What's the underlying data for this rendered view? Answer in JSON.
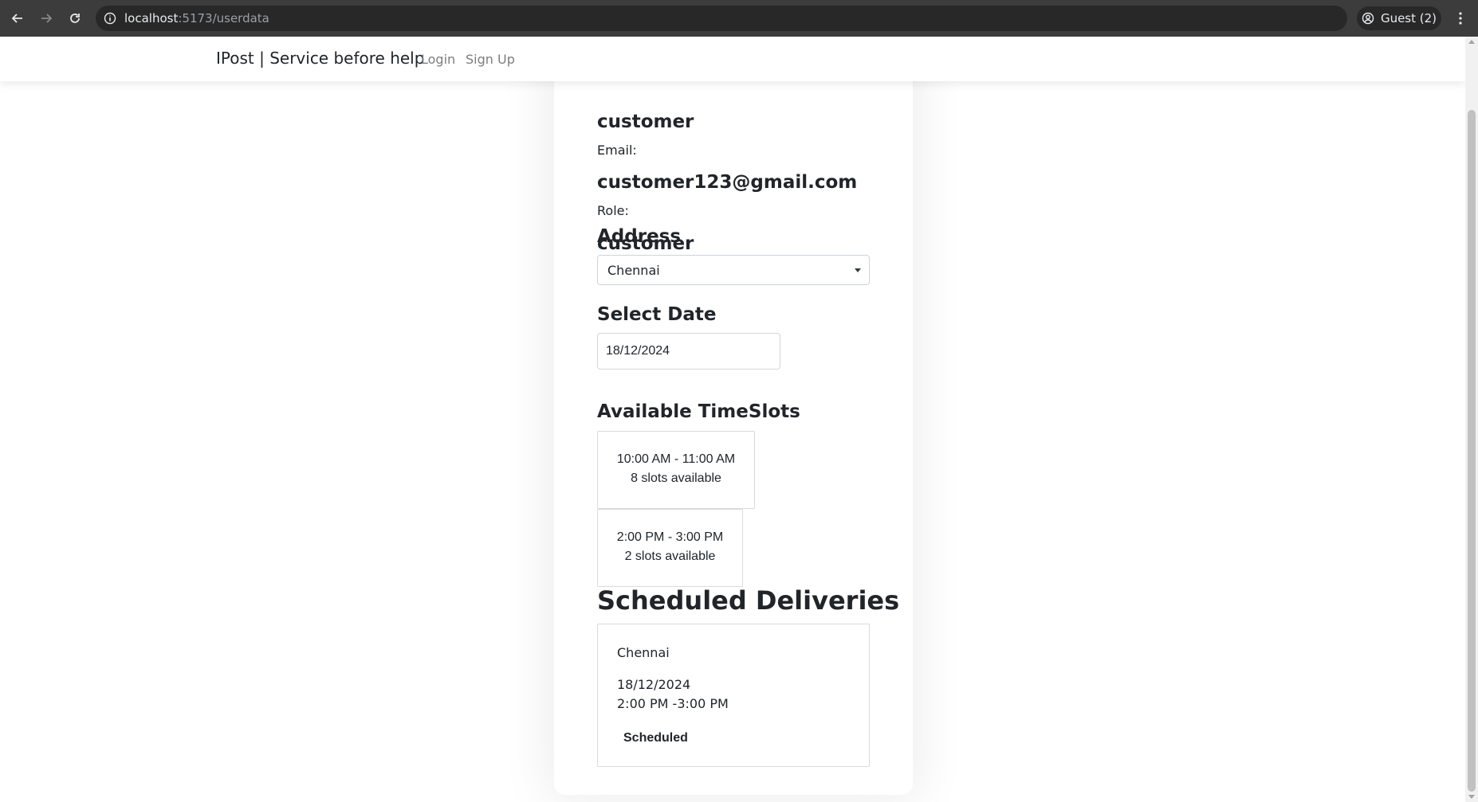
{
  "browser": {
    "url_host": "localhost",
    "url_path": ":5173/userdata",
    "profile_label": "Guest (2)"
  },
  "navbar": {
    "brand": "IPost | Service before help",
    "login": "Login",
    "signup": "Sign Up"
  },
  "profile": {
    "name_value": "customer",
    "email_label": "Email:",
    "email_value": "customer123@gmail.com",
    "role_label": "Role:",
    "role_value": "customer"
  },
  "address": {
    "heading": "Address",
    "selected": "Chennai"
  },
  "date": {
    "heading": "Select Date",
    "value": "18/12/2024"
  },
  "timeslots": {
    "heading": "Available TimeSlots",
    "items": [
      {
        "time": "10:00 AM - 11:00 AM",
        "availability": "8 slots available"
      },
      {
        "time": "2:00 PM - 3:00 PM",
        "availability": "2 slots available"
      }
    ]
  },
  "deliveries": {
    "heading": "Scheduled Deliveries",
    "items": [
      {
        "location": "Chennai",
        "date": "18/12/2024",
        "time": "2:00 PM -3:00 PM",
        "status": "Scheduled"
      }
    ]
  }
}
